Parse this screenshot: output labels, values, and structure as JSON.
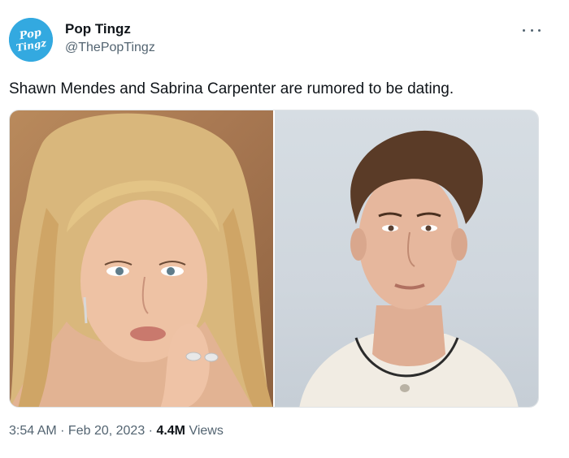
{
  "tweet": {
    "author_name": "Pop Tingz",
    "author_handle": "@ThePopTingz",
    "avatar_text_top": "Pop",
    "avatar_text_bottom": "Tingz",
    "text": "Shawn Mendes and Sabrina Carpenter are rumored to be dating.",
    "time": "3:54 AM",
    "separator": " · ",
    "date": "Feb 20, 2023",
    "views_count": "4.4M",
    "views_label": " Views"
  },
  "media": [
    {
      "icon": "portrait-woman-photo"
    },
    {
      "icon": "portrait-man-photo"
    }
  ],
  "colors": {
    "primary_text": "#0f1419",
    "secondary_text": "#536471",
    "avatar_bg": "#33a9e0"
  }
}
